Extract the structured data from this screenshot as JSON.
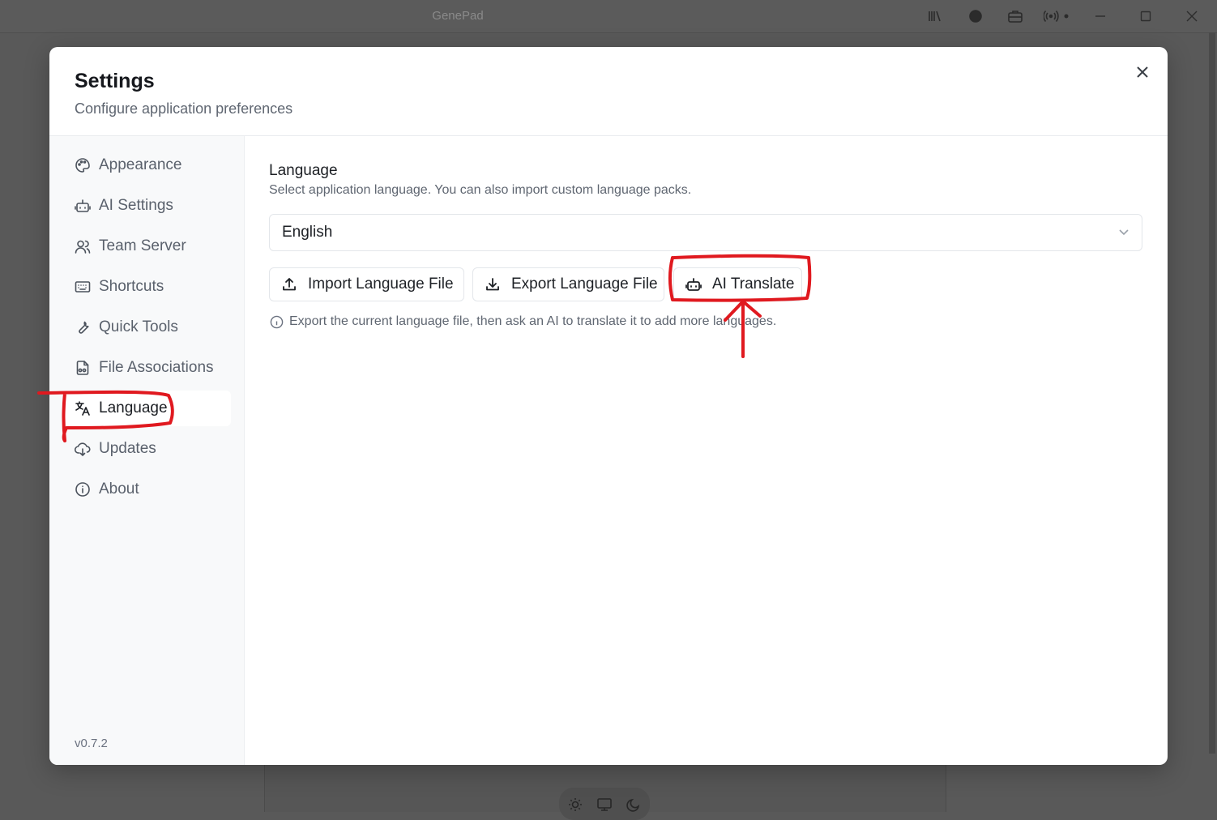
{
  "window": {
    "title": "GenePad",
    "toolbar_icons": [
      "library-icon",
      "ai-badge-icon",
      "briefcase-icon",
      "broadcast-icon"
    ],
    "controls": [
      "minimize-icon",
      "maximize-icon",
      "close-window-icon"
    ]
  },
  "modal": {
    "title": "Settings",
    "subtitle": "Configure application preferences",
    "close_icon": "close-icon"
  },
  "sidebar": {
    "items": [
      {
        "label": "Appearance",
        "icon": "palette-icon"
      },
      {
        "label": "AI Settings",
        "icon": "robot-icon"
      },
      {
        "label": "Team Server",
        "icon": "users-icon"
      },
      {
        "label": "Shortcuts",
        "icon": "keyboard-icon"
      },
      {
        "label": "Quick Tools",
        "icon": "wrench-icon"
      },
      {
        "label": "File Associations",
        "icon": "file-link-icon"
      },
      {
        "label": "Language",
        "icon": "translate-icon",
        "active": true
      },
      {
        "label": "Updates",
        "icon": "cloud-download-icon"
      },
      {
        "label": "About",
        "icon": "info-icon"
      }
    ],
    "version": "v0.7.2"
  },
  "language": {
    "title": "Language",
    "description": "Select application language. You can also import custom language packs.",
    "selected": "English",
    "buttons": {
      "import": "Import Language File",
      "export": "Export Language File",
      "ai_translate": "AI Translate"
    },
    "hint": "Export the current language file, then ask an AI to translate it to add more languages."
  },
  "bottom_bar": {
    "icons": [
      "sun-icon",
      "monitor-icon",
      "moon-icon"
    ]
  },
  "colors": {
    "annotation": "#e0191f",
    "backdrop": "#595959"
  }
}
